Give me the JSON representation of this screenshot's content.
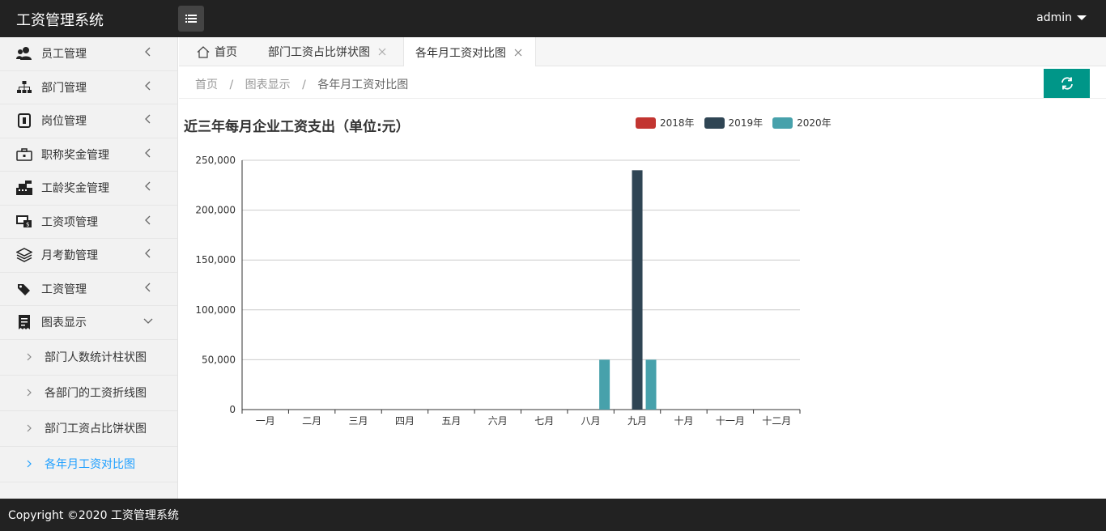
{
  "app": {
    "title": "工资管理系统",
    "user": "admin"
  },
  "sidebar": {
    "items": [
      {
        "label": "员工管理",
        "icon": "user-group-icon"
      },
      {
        "label": "部门管理",
        "icon": "sitemap-icon"
      },
      {
        "label": "岗位管理",
        "icon": "id-card-icon"
      },
      {
        "label": "职称奖金管理",
        "icon": "briefcase-icon"
      },
      {
        "label": "工龄奖金管理",
        "icon": "cash-register-icon"
      },
      {
        "label": "工资项管理",
        "icon": "money-screen-icon"
      },
      {
        "label": "月考勤管理",
        "icon": "layers-icon"
      },
      {
        "label": "工资管理",
        "icon": "tags-icon"
      },
      {
        "label": "图表显示",
        "icon": "receipt-icon"
      }
    ],
    "subitems": [
      {
        "label": "部门人数统计柱状图"
      },
      {
        "label": "各部门的工资折线图"
      },
      {
        "label": "部门工资占比饼状图"
      },
      {
        "label": "各年月工资对比图"
      }
    ]
  },
  "tabs": [
    {
      "label": "首页"
    },
    {
      "label": "部门工资占比饼状图"
    },
    {
      "label": "各年月工资对比图"
    }
  ],
  "breadcrumb": {
    "home": "首页",
    "section": "图表显示",
    "current": "各年月工资对比图",
    "separator": "/"
  },
  "footer": {
    "text": "Copyright ©2020 工资管理系统"
  },
  "chart_data": {
    "type": "bar",
    "title": "近三年每月企业工资支出（单位:元）",
    "categories": [
      "一月",
      "二月",
      "三月",
      "四月",
      "五月",
      "六月",
      "七月",
      "八月",
      "九月",
      "十月",
      "十一月",
      "十二月"
    ],
    "series": [
      {
        "name": "2018年",
        "color": "#c23531",
        "values": [
          0,
          0,
          0,
          0,
          0,
          0,
          0,
          0,
          0,
          0,
          0,
          0
        ]
      },
      {
        "name": "2019年",
        "color": "#2f4554",
        "values": [
          0,
          0,
          0,
          0,
          0,
          0,
          0,
          0,
          240000,
          0,
          0,
          0
        ]
      },
      {
        "name": "2020年",
        "color": "#47a1ab",
        "values": [
          0,
          0,
          0,
          0,
          0,
          0,
          0,
          50000,
          50000,
          0,
          0,
          0
        ]
      }
    ],
    "ylim": [
      0,
      250000
    ],
    "yticks": [
      0,
      50000,
      100000,
      150000,
      200000,
      250000
    ],
    "ytick_labels": [
      "0",
      "50,000",
      "100,000",
      "150,000",
      "200,000",
      "250,000"
    ],
    "grid": true,
    "legend_position": "top"
  }
}
